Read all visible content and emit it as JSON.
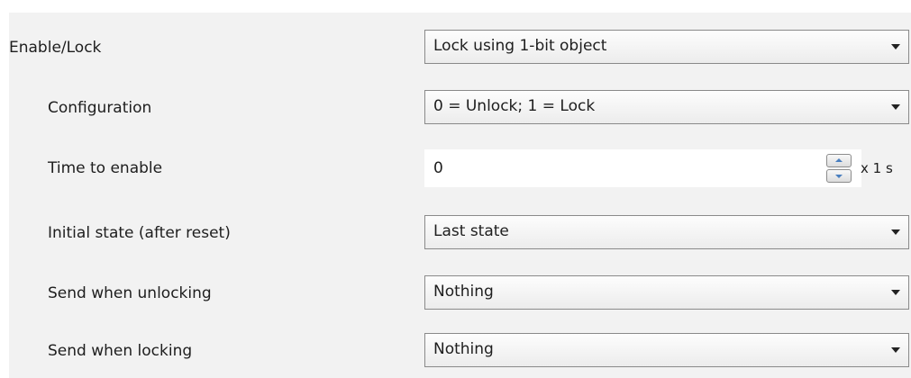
{
  "rows": {
    "enable_lock": {
      "label": "Enable/Lock",
      "value": "Lock using 1-bit object"
    },
    "configuration": {
      "label": "Configuration",
      "value": "0 = Unlock; 1 = Lock"
    },
    "time_to_enable": {
      "label": "Time to enable",
      "value": "0",
      "unit": "x 1 s"
    },
    "initial_state": {
      "label": "Initial state (after reset)",
      "value": "Last state"
    },
    "send_unlocking": {
      "label": "Send when unlocking",
      "value": "Nothing"
    },
    "send_locking": {
      "label": "Send when locking",
      "value": "Nothing"
    }
  },
  "icons": {
    "dropdown": "chevron-down-icon",
    "spin_up": "spin-up-icon",
    "spin_down": "spin-down-icon"
  }
}
